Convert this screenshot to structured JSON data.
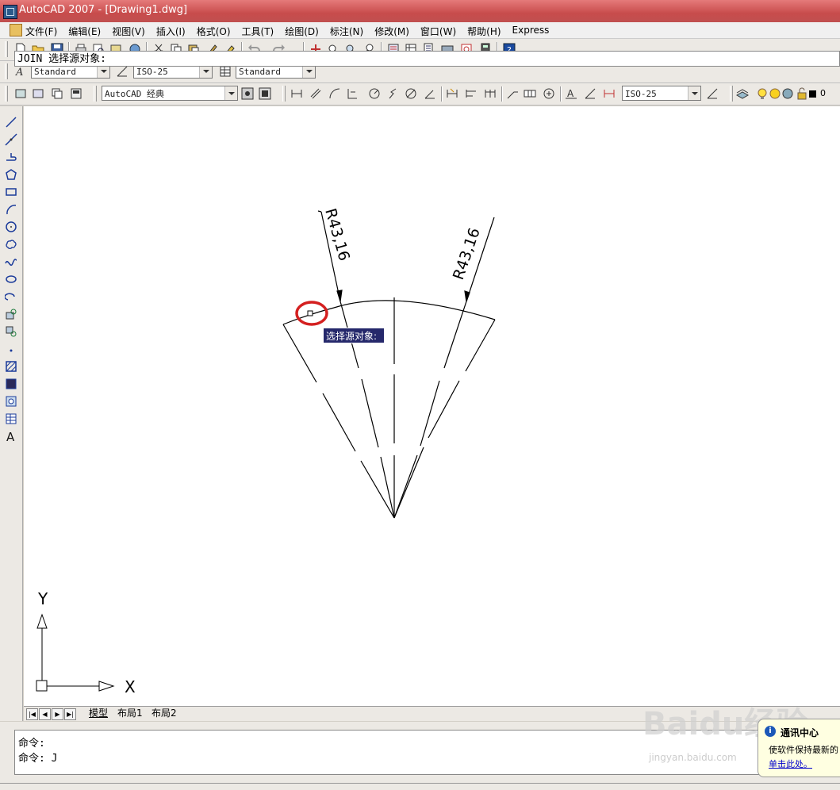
{
  "window": {
    "title": "AutoCAD 2007 - [Drawing1.dwg]"
  },
  "menu": [
    "文件(F)",
    "编辑(E)",
    "视图(V)",
    "插入(I)",
    "格式(O)",
    "工具(T)",
    "绘图(D)",
    "标注(N)",
    "修改(M)",
    "窗口(W)",
    "帮助(H)",
    "Express"
  ],
  "styles": {
    "text_style": "Standard",
    "dim_style": "ISO-25",
    "table_style": "Standard"
  },
  "workspace": {
    "name": "AutoCAD 经典"
  },
  "dim_toolbar": {
    "dim_style": "ISO-25"
  },
  "layer": {
    "name": "0"
  },
  "drawing": {
    "dim_left": "R43,16",
    "dim_right": "R43,16",
    "ucs_x": "X",
    "ucs_y": "Y"
  },
  "tooltip": "选择源对象:",
  "layout_tabs": [
    "模型",
    "布局1",
    "布局2"
  ],
  "command": {
    "line1": "命令:",
    "line2": "命令: J",
    "prompt": "JOIN 选择源对象:"
  },
  "balloon": {
    "title": "通讯中心",
    "message": "使软件保持最新的",
    "link": "单击此处。"
  },
  "watermark": {
    "brand": "Baidu经验",
    "url": "jingyan.baidu.com"
  },
  "colors": {
    "title_bar": "#c84c4c",
    "tooltip_bg": "#25286b",
    "highlight_circle": "#d42020"
  }
}
